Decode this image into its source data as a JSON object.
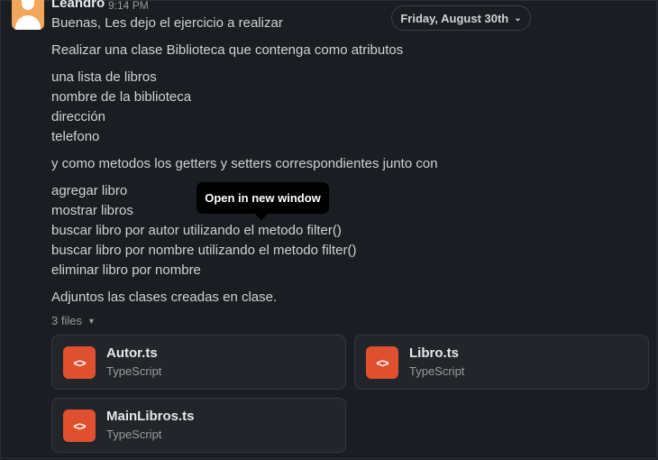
{
  "message": {
    "sender": "Leandro",
    "time": "9:14 PM",
    "lines": [
      "Buenas, Les dejo el ejercicio a realizar",
      "Realizar una clase Biblioteca que contenga como atributos",
      "una lista de libros",
      "nombre de la biblioteca",
      "dirección",
      "telefono",
      "y como metodos los getters y setters correspondientes junto con",
      "agregar libro",
      "mostrar libros",
      "buscar libro por autor utilizando el metodo filter()",
      "buscar libro por nombre utilizando el metodo filter()",
      "eliminar libro por nombre",
      "Adjuntos las clases creadas en clase."
    ]
  },
  "date_divider": {
    "label": "Friday, August 30th",
    "icon": "chevron-down-icon"
  },
  "tooltip": {
    "text": "Open in new window"
  },
  "files": {
    "toggle_label": "3 files",
    "items": [
      {
        "name": "Autor.ts",
        "type": "TypeScript",
        "icon": "code-file-icon",
        "icon_color": "#e0502f"
      },
      {
        "name": "Libro.ts",
        "type": "TypeScript",
        "icon": "code-file-icon",
        "icon_color": "#e0502f"
      },
      {
        "name": "MainLibros.ts",
        "type": "TypeScript",
        "icon": "code-file-icon",
        "icon_color": "#e0502f"
      }
    ]
  },
  "colors": {
    "background": "#1a1d21",
    "card": "#222529",
    "accent": "#e0502f"
  }
}
